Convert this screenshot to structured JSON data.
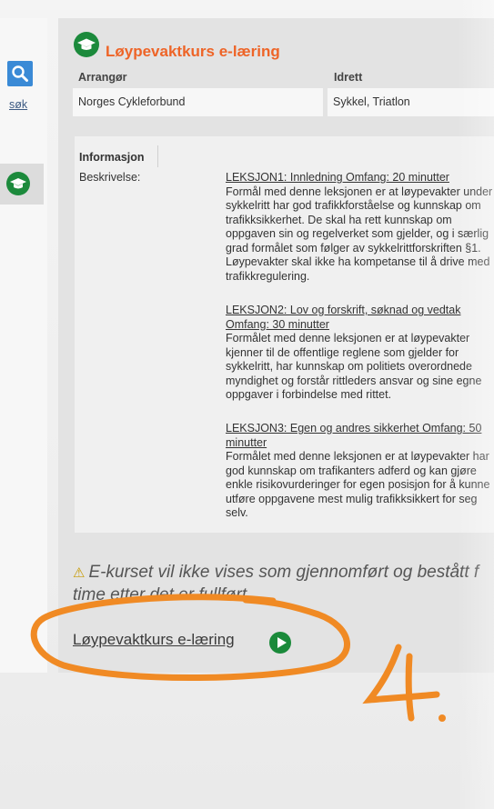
{
  "sidebar": {
    "search_link": "søk",
    "search_icon": "magnifier-icon",
    "tile_icon": "graduation-cap-icon"
  },
  "course": {
    "title": "Løypevaktkurs e-læring",
    "columns": [
      "Arrangør",
      "Idrett"
    ],
    "organizer": "Norges Cykleforbund",
    "sport": "Sykkel, Triatlon"
  },
  "info": {
    "heading": "Informasjon",
    "label": "Beskrivelse:",
    "lessons": [
      {
        "heading": [
          "LEKSJON1: Innledning Omfang: 20 minutter"
        ],
        "body": [
          "Formål med denne leksjonen er at løypevakter under",
          "sykkelritt har god trafikkforståelse og kunnskap om",
          "trafikksikkerhet. De skal ha rett kunnskap om",
          "oppgaven sin og regelverket som gjelder, og i særlig",
          "grad formålet som følger av sykkelrittforskriften §1.",
          "Løypevakter skal ikke ha kompetanse til å drive med",
          "trafikkregulering."
        ]
      },
      {
        "heading": [
          "LEKSJON2: Lov og forskrift, søknad og vedtak",
          "Omfang: 30 minutter"
        ],
        "body": [
          "Formålet med denne leksjonen er at løypevakter",
          "kjenner til de offentlige reglene som gjelder for",
          "sykkelritt, har kunnskap om politiets overordnede",
          "myndighet og forstår rittleders ansvar og sine egne",
          "oppgaver i forbindelse med rittet."
        ]
      },
      {
        "heading": [
          "LEKSJON3: Egen og andres sikkerhet Omfang: 50",
          "minutter"
        ],
        "body": [
          "Formålet med denne leksjonen er at løypevakter har",
          "god kunnskap om trafikanters adferd og kan gjøre",
          "enkle risikovurderinger for egen posisjon for å kunne",
          "utføre oppgavene mest mulig trafikksikkert for seg",
          "selv."
        ]
      }
    ]
  },
  "warning": {
    "line1": "E-kurset vil ikke vises som gjennomført og bestått f",
    "line2": "time etter det er fullført",
    "icon": "warning-icon"
  },
  "course_link": {
    "label": "Løypevaktkurs e-læring",
    "icon": "play-icon"
  },
  "annotation": {
    "text": "4.",
    "color": "#f08a24"
  }
}
